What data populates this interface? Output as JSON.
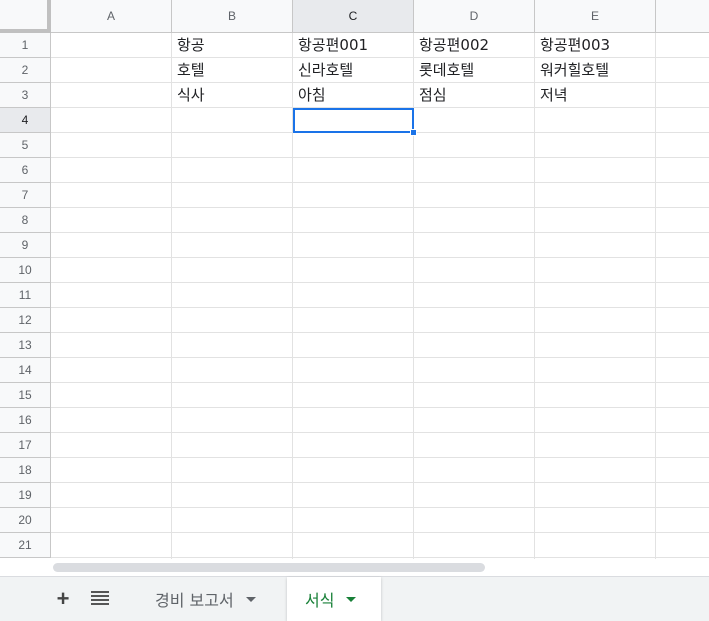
{
  "columns": [
    "A",
    "B",
    "C",
    "D",
    "E"
  ],
  "active_column": "C",
  "rows": [
    "1",
    "2",
    "3",
    "4",
    "5",
    "6",
    "7",
    "8",
    "9",
    "10",
    "11",
    "12",
    "13",
    "14",
    "15",
    "16",
    "17",
    "18",
    "19",
    "20",
    "21"
  ],
  "active_row": "4",
  "cells": {
    "B1": "항공",
    "C1": "항공편001",
    "D1": "항공편002",
    "E1": "항공편003",
    "B2": "호텔",
    "C2": "신라호텔",
    "D2": "롯데호텔",
    "E2": "워커힐호텔",
    "B3": "식사",
    "C3": "아침",
    "D3": "점심",
    "E3": "저녁"
  },
  "selected_cell": "C4",
  "sheet_tabs": [
    {
      "label": "경비 보고서",
      "active": false
    },
    {
      "label": "서식",
      "active": true
    }
  ],
  "colors": {
    "selection": "#1a73e8",
    "active_tab_text": "#188038"
  },
  "icons": {
    "add_sheet": "plus-icon",
    "all_sheets": "list-icon"
  }
}
